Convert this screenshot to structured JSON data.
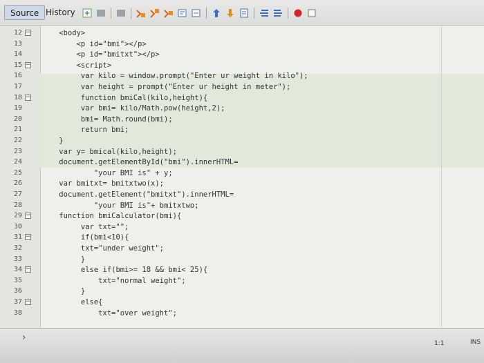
{
  "tabs": [
    {
      "label": "Source",
      "active": true
    },
    {
      "label": "History",
      "active": false
    }
  ],
  "toolbar_icons": [
    "last-edit-icon",
    "back-icon",
    "forward-icon",
    "find-selection-icon",
    "find-previous-icon",
    "find-next-icon",
    "toggle-highlight-icon",
    "toggle-rect-selection-icon",
    "previous-bookmark-icon",
    "next-bookmark-icon",
    "toggle-bookmark-icon",
    "shift-left-icon",
    "shift-right-icon",
    "start-macro-icon",
    "stop-macro-icon"
  ],
  "editor": {
    "lines": [
      {
        "num": "12",
        "text": "    <body>",
        "fold": "minus"
      },
      {
        "num": "13",
        "text": "        <p id=\"bmi\"></p>",
        "fold": ""
      },
      {
        "num": "14",
        "text": "        <p id=\"bmitxt\"></p>",
        "fold": ""
      },
      {
        "num": "15",
        "text": "        <script>",
        "fold": "minus"
      },
      {
        "num": "16",
        "text": "         var kilo = window.prompt(\"Enter ur weight in kilo\");",
        "fold": ""
      },
      {
        "num": "17",
        "text": "         var height = prompt(\"Enter ur height in meter\");",
        "fold": ""
      },
      {
        "num": "18",
        "text": "         function bmiCal(kilo,height){",
        "fold": "minus"
      },
      {
        "num": "19",
        "text": "         var bmi= kilo/Math.pow(height,2);",
        "fold": ""
      },
      {
        "num": "20",
        "text": "         bmi= Math.round(bmi);",
        "fold": ""
      },
      {
        "num": "21",
        "text": "         return bmi;",
        "fold": ""
      },
      {
        "num": "22",
        "text": "    }",
        "fold": ""
      },
      {
        "num": "23",
        "text": "    var y= bmical(kilo,height);",
        "fold": ""
      },
      {
        "num": "24",
        "text": "    document.getElementById(\"bmi\").innerHTML=",
        "fold": ""
      },
      {
        "num": "25",
        "text": "            \"your BMI is\" + y;",
        "fold": ""
      },
      {
        "num": "26",
        "text": "    var bmitxt= bmitxtwo(x);",
        "fold": ""
      },
      {
        "num": "27",
        "text": "    document.getElement(\"bmitxt\").innerHTML=",
        "fold": ""
      },
      {
        "num": "28",
        "text": "            \"your BMI is\"+ bmitxtwo;",
        "fold": ""
      },
      {
        "num": "29",
        "text": "    function bmiCalculator(bmi){",
        "fold": "minus"
      },
      {
        "num": "30",
        "text": "         var txt=\"\";",
        "fold": ""
      },
      {
        "num": "31",
        "text": "         if(bmi<10){",
        "fold": "minus"
      },
      {
        "num": "32",
        "text": "         txt=\"under weight\";",
        "fold": ""
      },
      {
        "num": "33",
        "text": "         }",
        "fold": ""
      },
      {
        "num": "34",
        "text": "         else if(bmi>= 18 && bmi< 25){",
        "fold": "minus"
      },
      {
        "num": "35",
        "text": "             txt=\"normal weight\";",
        "fold": ""
      },
      {
        "num": "36",
        "text": "         }",
        "fold": ""
      },
      {
        "num": "37",
        "text": "         else{",
        "fold": "minus"
      },
      {
        "num": "38",
        "text": "             txt=\"over weight\";",
        "fold": ""
      }
    ]
  },
  "status": {
    "position": "1:1",
    "mode": "INS"
  }
}
